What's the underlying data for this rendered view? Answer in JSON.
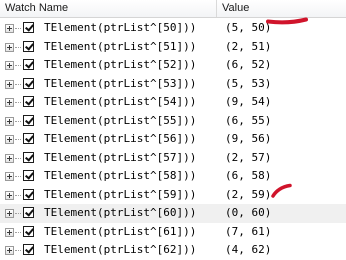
{
  "header": {
    "name_label": "Watch Name",
    "value_label": "Value"
  },
  "rows": [
    {
      "name": "TElement(ptrList^[50]))",
      "value": "(5, 50)"
    },
    {
      "name": "TElement(ptrList^[51]))",
      "value": "(2, 51)"
    },
    {
      "name": "TElement(ptrList^[52]))",
      "value": "(6, 52)"
    },
    {
      "name": "TElement(ptrList^[53]))",
      "value": "(5, 53)"
    },
    {
      "name": "TElement(ptrList^[54]))",
      "value": "(9, 54)"
    },
    {
      "name": "TElement(ptrList^[55]))",
      "value": "(6, 55)"
    },
    {
      "name": "TElement(ptrList^[56]))",
      "value": "(9, 56)"
    },
    {
      "name": "TElement(ptrList^[57]))",
      "value": "(2, 57)"
    },
    {
      "name": "TElement(ptrList^[58]))",
      "value": "(6, 58)"
    },
    {
      "name": "TElement(ptrList^[59]))",
      "value": "(2, 59)"
    },
    {
      "name": "TElement(ptrList^[60]))",
      "value": "(0, 60)"
    },
    {
      "name": "TElement(ptrList^[61]))",
      "value": "(7, 61)"
    },
    {
      "name": "TElement(ptrList^[62]))",
      "value": "(4, 62)"
    }
  ],
  "selected_row": 10,
  "colors": {
    "annotation": "#d0142b",
    "selected_row": "#f0f0f0"
  },
  "icons": {
    "expander": "plus-box-icon",
    "enabled": "checkbox-checked-icon"
  }
}
